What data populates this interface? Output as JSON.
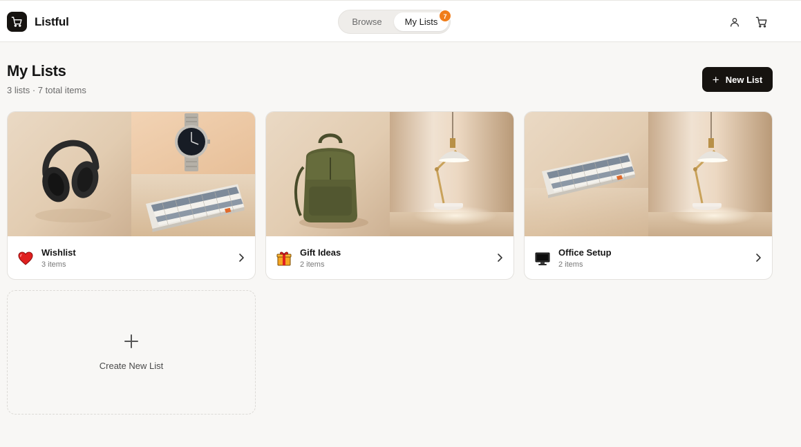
{
  "app": {
    "name": "Listful",
    "logo_icon": "cart-icon"
  },
  "nav": {
    "browse_label": "Browse",
    "my_lists_label": "My Lists",
    "active": "My Lists",
    "badge_count": "7",
    "badge_color": "#f07d1a"
  },
  "header_icons": [
    "user-icon",
    "cart-icon"
  ],
  "page": {
    "title": "My Lists",
    "subtitle": "3 lists · 7 total items",
    "new_list_label": "New List"
  },
  "lists": [
    {
      "name": "Wishlist",
      "count": "3 items",
      "emoji": "heart-icon",
      "thumbnails": [
        "headphones",
        "wristwatch",
        "mechanical-keyboard"
      ]
    },
    {
      "name": "Gift Ideas",
      "count": "2 items",
      "emoji": "gift-icon",
      "thumbnails": [
        "backpack",
        "desk-lamp"
      ]
    },
    {
      "name": "Office Setup",
      "count": "2 items",
      "emoji": "monitor-icon",
      "thumbnails": [
        "mechanical-keyboard",
        "desk-lamp"
      ]
    }
  ],
  "create_card": {
    "label": "Create New List"
  },
  "colors": {
    "primary": "#161310",
    "background": "#f8f7f5",
    "accent": "#f07d1a"
  }
}
